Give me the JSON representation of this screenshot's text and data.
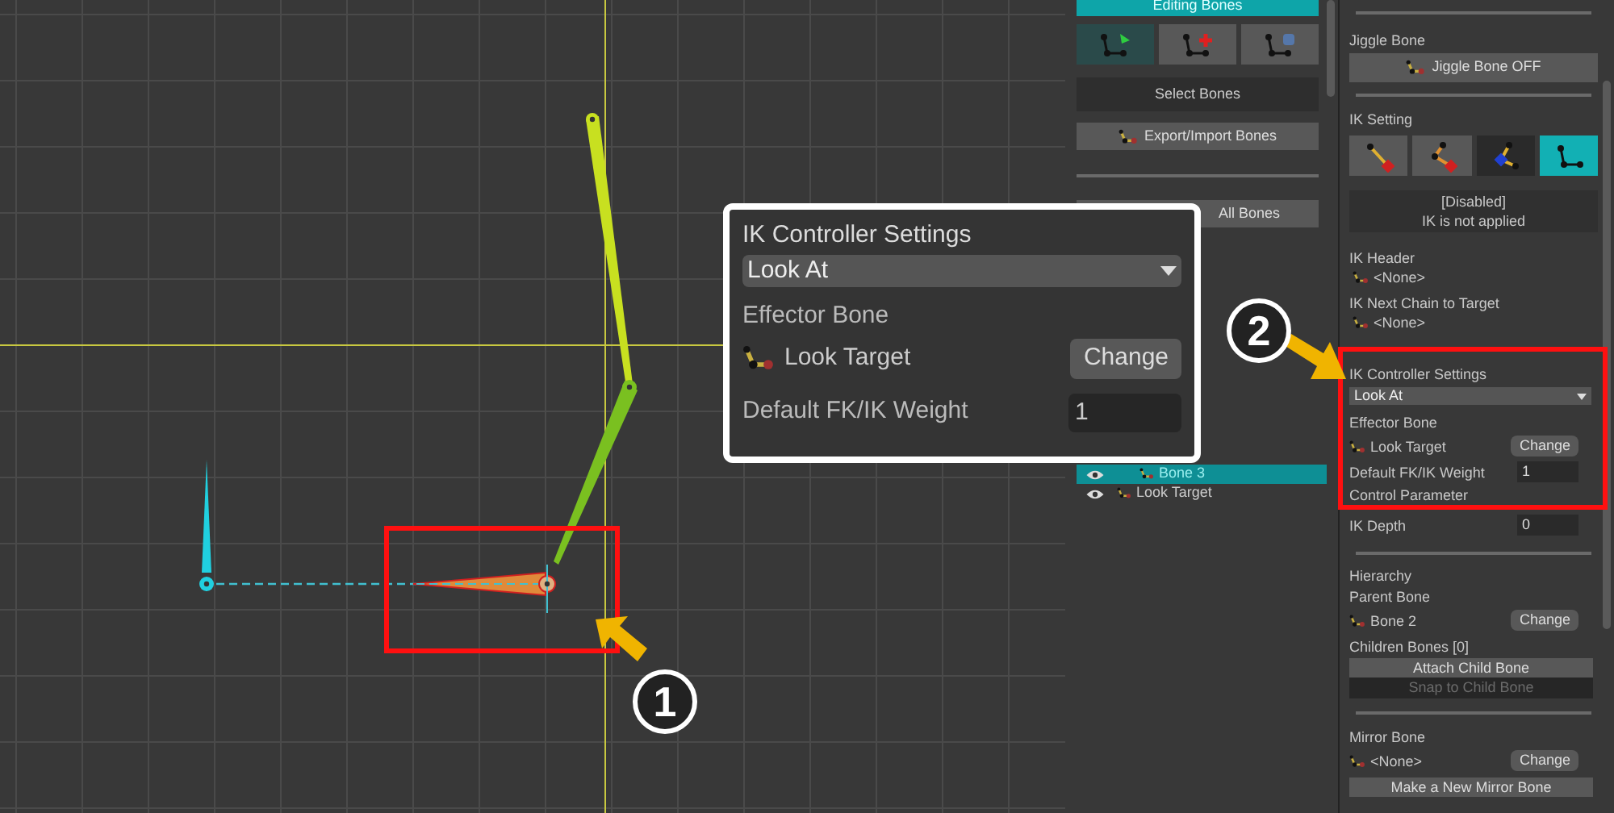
{
  "annotations": [
    {
      "number": "1"
    },
    {
      "number": "2"
    }
  ],
  "callout": {
    "title": "IK Controller Settings",
    "mode": "Look At",
    "effector_label": "Effector Bone",
    "effector_bone": "Look Target",
    "change_button": "Change",
    "weight_label": "Default FK/IK Weight",
    "weight_value": "1"
  },
  "bones_panel": {
    "editing_button": "Editing Bones",
    "tools": [
      {
        "kind": "select",
        "selected": true
      },
      {
        "kind": "add",
        "selected": false
      },
      {
        "kind": "link",
        "selected": false
      }
    ],
    "select_button": "Select Bones",
    "export_button": "Export/Import Bones",
    "all_bones_button": "All Bones",
    "bone_list": [
      {
        "name": "Bone 3",
        "selected": true
      },
      {
        "name": "Look Target",
        "selected": false
      }
    ]
  },
  "inspector": {
    "jiggle_label": "Jiggle Bone",
    "jiggle_button": "Jiggle Bone OFF",
    "ik_label": "IK Setting",
    "ik_modes": [
      {
        "kind": "single",
        "selected": false
      },
      {
        "kind": "chain",
        "selected": false
      },
      {
        "kind": "lookat",
        "selected": false
      },
      {
        "kind": "disabled",
        "selected": true
      }
    ],
    "ik_status": [
      "[Disabled]",
      "IK is not applied"
    ],
    "ik_header_label": "IK Header",
    "ik_header_value": "<None>",
    "next_chain_label": "IK Next Chain to Target",
    "next_chain_value": "<None>",
    "controller_label": "IK Controller Settings",
    "controller_mode": "Look At",
    "effector_label": "Effector Bone",
    "effector_bone": "Look Target",
    "effector_change": "Change",
    "weight_label": "Default FK/IK Weight",
    "weight_value": "1",
    "control_param_label": "Control Parameter",
    "depth_label": "IK Depth",
    "depth_value": "0",
    "hierarchy_label": "Hierarchy",
    "parent_label": "Parent Bone",
    "parent_bone": "Bone 2",
    "parent_change": "Change",
    "children_label": "Children Bones [0]",
    "attach_button": "Attach Child Bone",
    "snap_button": {
      "label": "Snap to Child Bone",
      "disabled": true
    },
    "mirror_label": "Mirror Bone",
    "mirror_value": "<None>",
    "mirror_change": "Change",
    "mirror_make_button": "Make a New Mirror Bone"
  }
}
